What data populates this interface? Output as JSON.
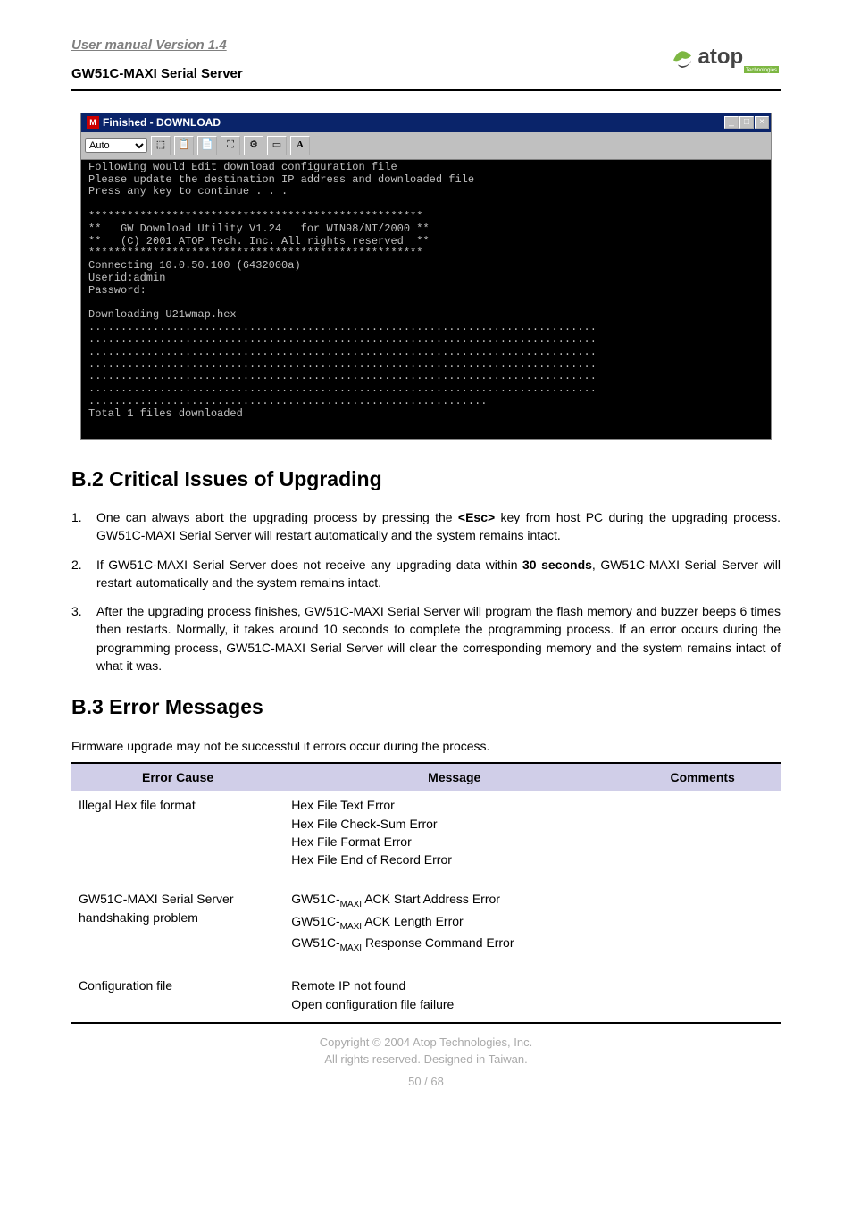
{
  "header": {
    "manual_version": "User manual Version 1.4",
    "product_name": "GW51C-MAXI Serial Server",
    "logo_primary": "atop",
    "logo_secondary": "Technologies"
  },
  "terminal": {
    "title": "Finished - DOWNLOAD",
    "toolbar_select": "Auto",
    "toolbar_a": "A",
    "body_lines": "Following would Edit download configuration file\nPlease update the destination IP address and downloaded file\nPress any key to continue . . .\n\n****************************************************\n**   GW Download Utility V1.24   for WIN98/NT/2000 **\n**   (C) 2001 ATOP Tech. Inc. All rights reserved  **\n****************************************************\nConnecting 10.0.50.100 (6432000a)\nUserid:admin\nPassword:\n\nDownloading U21wmap.hex\n...............................................................................\n...............................................................................\n...............................................................................\n...............................................................................\n...............................................................................\n...............................................................................\n..............................................................\nTotal 1 files downloaded"
  },
  "section_b2": {
    "title": "B.2 Critical Issues of Upgrading",
    "items": [
      "One can always abort the upgrading process by pressing the <Esc> key from host PC during the upgrading process. GW51C-MAXI Serial Server will restart automatically and the system remains intact.",
      "If GW51C-MAXI Serial Server does not receive any upgrading data within 30 seconds, GW51C-MAXI Serial Server will restart automatically and the system remains intact.",
      "After the upgrading process finishes, GW51C-MAXI Serial Server will program the flash memory and buzzer beeps 6 times then restarts. Normally, it takes around 10 seconds to complete the programming process. If an error occurs during the programming process, GW51C-MAXI Serial Server will clear the corresponding memory and the system remains intact of what it was."
    ]
  },
  "section_b3": {
    "title": "B.3 Error Messages",
    "intro": "Firmware upgrade may not be successful if errors occur during the process.",
    "headers": {
      "cause": "Error Cause",
      "message": "Message",
      "comments": "Comments"
    },
    "rows": [
      {
        "cause": "Illegal Hex file format",
        "message": "Hex File Text Error\nHex File Check-Sum Error\nHex File Format Error\nHex File End of Record Error",
        "comments": ""
      },
      {
        "cause": "GW51C-MAXI Serial Server handshaking problem",
        "message_html": "GW51C-<span class=\"sub\">MAXI</span> ACK Start Address Error<br>GW51C-<span class=\"sub\">MAXI</span> ACK Length Error<br>GW51C-<span class=\"sub\">MAXI</span> Response Command Error",
        "comments": ""
      },
      {
        "cause": "Configuration file",
        "message": "Remote IP not found\nOpen configuration file failure",
        "comments": ""
      }
    ]
  },
  "footer": {
    "copyright": "Copyright © 2004 Atop Technologies, Inc.",
    "rights": "All rights reserved. Designed in Taiwan.",
    "page": "50 / 68"
  }
}
